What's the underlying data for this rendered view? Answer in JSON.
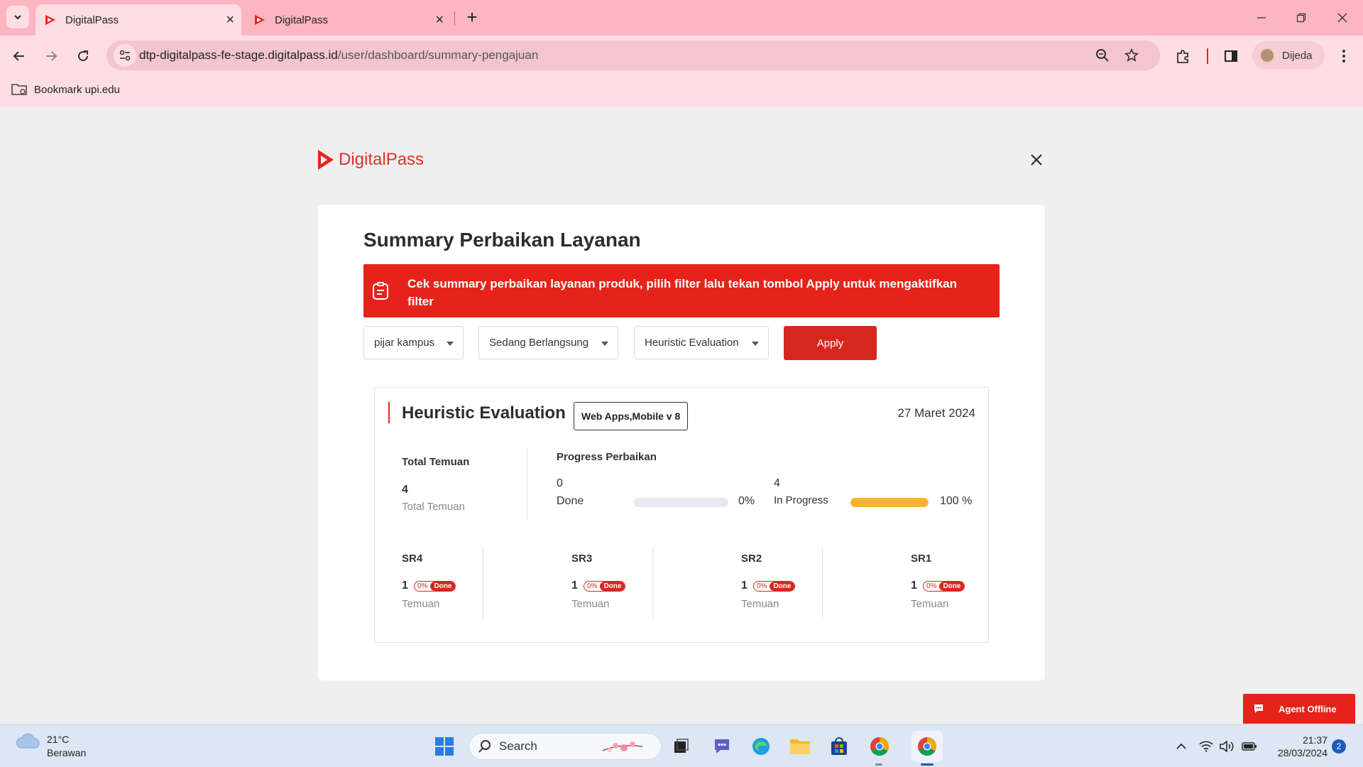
{
  "browser": {
    "tabs": [
      {
        "title": "DigitalPass",
        "active": true
      },
      {
        "title": "DigitalPass",
        "active": false
      }
    ],
    "url_host": "dtp-digitalpass-fe-stage.digitalpass.id",
    "url_path": "/user/dashboard/summary-pengajuan",
    "profile_name": "Dijeda",
    "bookmark": "Bookmark upi.edu"
  },
  "page": {
    "logo_text": "DigitalPass",
    "title": "Summary Perbaikan Layanan",
    "banner_text": "Cek summary perbaikan layanan produk, pilih filter lalu tekan tombol Apply untuk mengaktifkan filter",
    "filters": {
      "product": "pijar kampus",
      "status": "Sedang Berlangsung",
      "method": "Heuristic Evaluation"
    },
    "apply_label": "Apply",
    "evaluation": {
      "title": "Heuristic Evaluation",
      "tag": "Web Apps,Mobile v 8",
      "date": "27 Maret 2024",
      "total_label": "Total Temuan",
      "total_value": "4",
      "total_sub": "Total Temuan",
      "progress_label": "Progress Perbaikan",
      "done_count": "0",
      "done_label": "Done",
      "done_pct_text": "0%",
      "done_fraction": 0,
      "inprogress_count": "4",
      "inprogress_label": "In Progress",
      "inprogress_pct_text": "100 %",
      "inprogress_fraction": 1,
      "srs": [
        {
          "name": "SR4",
          "count": "1",
          "pct": "0%",
          "status": "Done",
          "sub": "Temuan"
        },
        {
          "name": "SR3",
          "count": "1",
          "pct": "0%",
          "status": "Done",
          "sub": "Temuan"
        },
        {
          "name": "SR2",
          "count": "1",
          "pct": "0%",
          "status": "Done",
          "sub": "Temuan"
        },
        {
          "name": "SR1",
          "count": "1",
          "pct": "0%",
          "status": "Done",
          "sub": "Temuan"
        }
      ]
    },
    "agent_label": "Agent Offline"
  },
  "taskbar": {
    "weather_temp": "21°C",
    "weather_desc": "Berawan",
    "search_label": "Search",
    "time": "21:37",
    "date": "28/03/2024",
    "notification_count": "2"
  },
  "colors": {
    "brand_red": "#e5231b",
    "progress_orange": "#f9b42d",
    "progress_track": "#e6e9f1",
    "browser_pink": "#fdb5c2"
  }
}
